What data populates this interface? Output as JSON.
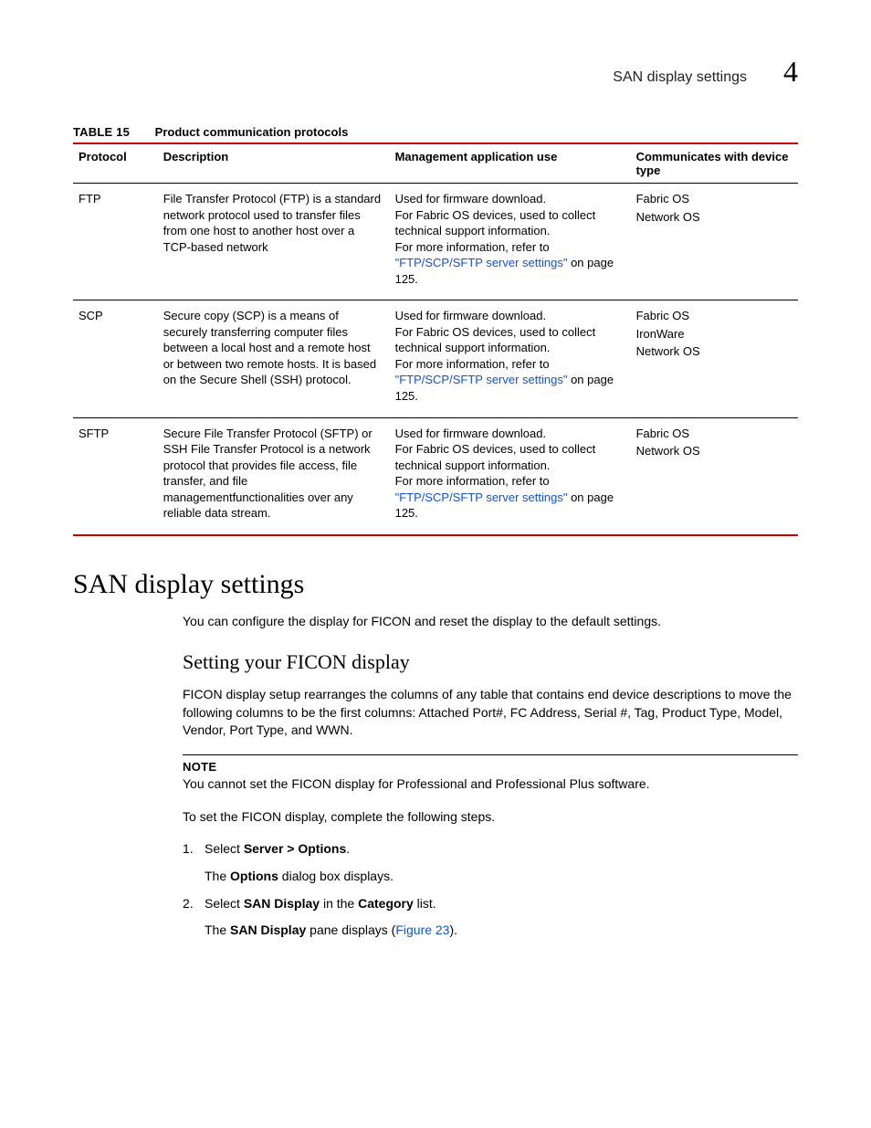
{
  "header": {
    "title": "SAN display settings",
    "chapter": "4"
  },
  "table": {
    "label": "TABLE 15",
    "title": "Product communication protocols",
    "headers": {
      "protocol": "Protocol",
      "description": "Description",
      "use": "Management application use",
      "communicates": "Communicates with device type"
    },
    "rows": [
      {
        "protocol": "FTP",
        "description": "File Transfer Protocol (FTP) is a standard network protocol used to transfer files from one host to another host over a TCP-based network",
        "use_line1": "Used for firmware download.",
        "use_line2": "For Fabric OS devices, used to collect technical support information.",
        "use_line3": "For more information, refer to ",
        "use_link": "\"FTP/SCP/SFTP server settings\"",
        "use_line4": " on page 125.",
        "dev1": "Fabric OS",
        "dev2": "Network OS",
        "dev3": ""
      },
      {
        "protocol": "SCP",
        "description": "Secure copy (SCP) is a means of securely transferring computer files between a local host and a remote host or between two remote hosts. It is based on the Secure Shell (SSH) protocol.",
        "use_line1": "Used for firmware download.",
        "use_line2": "For Fabric OS devices, used to collect technical support information.",
        "use_line3": "For more information, refer to ",
        "use_link": "\"FTP/SCP/SFTP server settings\"",
        "use_line4": " on page 125.",
        "dev1": "Fabric OS",
        "dev2": "IronWare",
        "dev3": "Network OS"
      },
      {
        "protocol": "SFTP",
        "description": "Secure File Transfer Protocol (SFTP) or SSH File Transfer Protocol is a network protocol that provides file access, file transfer, and file managementfunctionalities over any reliable data stream.",
        "use_line1": "Used for firmware download.",
        "use_line2": "For Fabric OS devices, used to collect technical support information.",
        "use_line3": "For more information, refer to ",
        "use_link": "\"FTP/SCP/SFTP server settings\"",
        "use_line4": " on page 125.",
        "dev1": "Fabric OS",
        "dev2": "Network OS",
        "dev3": ""
      }
    ]
  },
  "section": {
    "heading": "SAN display settings",
    "intro": "You can configure the display for FICON and reset the display to the default settings.",
    "subheading": "Setting your FICON display",
    "para1": "FICON display setup rearranges the columns of any table that contains end device descriptions to move the following columns to be the first columns: Attached Port#, FC Address, Serial #, Tag, Product Type, Model, Vendor, Port Type, and WWN.",
    "note_label": "NOTE",
    "note_text": "You cannot set the FICON display for Professional and Professional Plus software.",
    "steps_intro": "To set the FICON display, complete the following steps.",
    "step1_num": "1.",
    "step1_prefix": "Select ",
    "step1_bold": "Server > Options",
    "step1_suffix": ".",
    "step1_result_prefix": "The ",
    "step1_result_bold": "Options",
    "step1_result_suffix": " dialog box displays.",
    "step2_num": "2.",
    "step2_prefix": "Select ",
    "step2_bold1": "SAN Display",
    "step2_mid": " in the ",
    "step2_bold2": "Category",
    "step2_suffix": " list.",
    "step2_result_prefix": "The ",
    "step2_result_bold": "SAN Display",
    "step2_result_mid": " pane displays (",
    "step2_result_link": "Figure 23",
    "step2_result_suffix": ")."
  }
}
